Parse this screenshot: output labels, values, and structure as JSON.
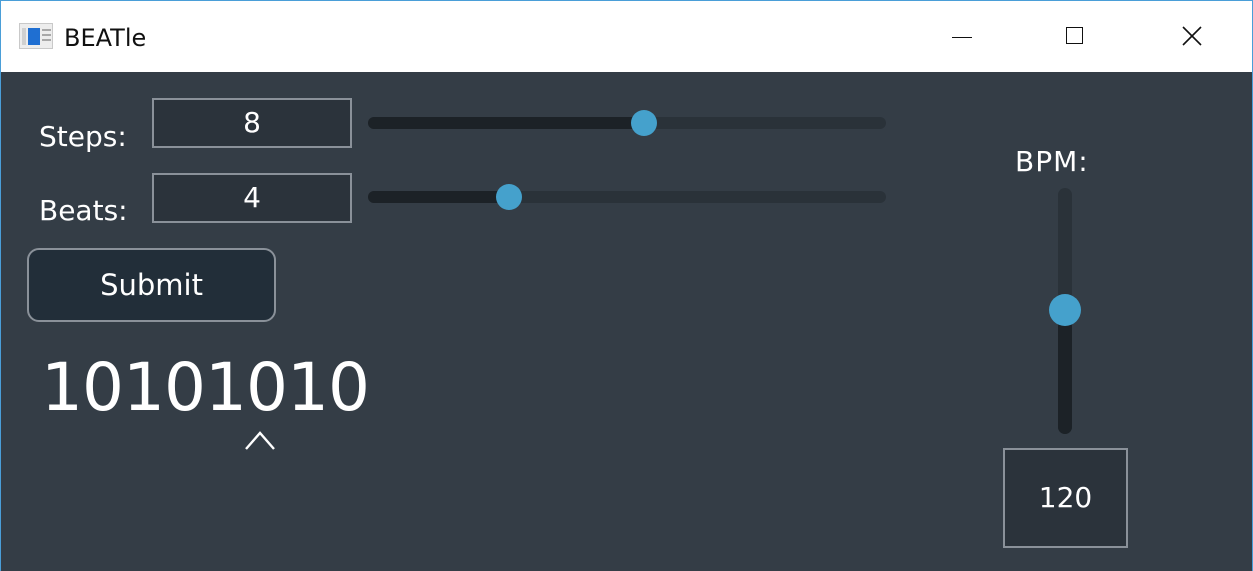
{
  "window": {
    "title": "BEATle",
    "controls": {
      "minimize": "minimize-icon",
      "maximize": "maximize-icon",
      "close": "close-icon"
    }
  },
  "steps": {
    "label": "Steps:",
    "value": "8",
    "slider_fraction": 0.54
  },
  "beats": {
    "label": "Beats:",
    "value": "4",
    "slider_fraction": 0.27
  },
  "submit_label": "Submit",
  "pattern": {
    "text": "10101010",
    "marker": "^",
    "marker_index": 6
  },
  "bpm": {
    "label": "BPM:",
    "value": "120",
    "slider_fraction": 0.5
  },
  "colors": {
    "background": "#343d46",
    "accent": "#45a1cc",
    "field_border": "#8a9199",
    "text": "#ffffff"
  }
}
